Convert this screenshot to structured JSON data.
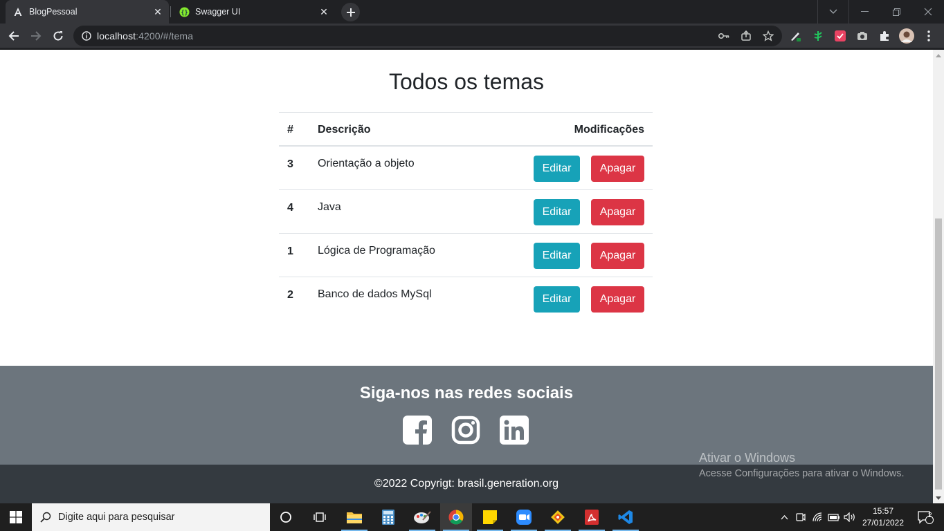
{
  "browser": {
    "tabs": [
      {
        "title": "BlogPessoal"
      },
      {
        "title": "Swagger UI"
      }
    ],
    "url_host": "localhost",
    "url_path": ":4200/#/tema"
  },
  "page": {
    "title": "Todos os temas",
    "table": {
      "headers": [
        "#",
        "Descrição",
        "Modificações"
      ],
      "rows": [
        {
          "id": "3",
          "descricao": "Orientação a objeto"
        },
        {
          "id": "4",
          "descricao": "Java"
        },
        {
          "id": "1",
          "descricao": "Lógica de Programação"
        },
        {
          "id": "2",
          "descricao": "Banco de dados MySql"
        }
      ],
      "edit_label": "Editar",
      "delete_label": "Apagar"
    },
    "footer": {
      "social_heading": "Siga-nos nas redes sociais",
      "social_icons": [
        "facebook-icon",
        "instagram-icon",
        "linkedin-icon"
      ],
      "copyright": "©2022 Copyrigt: brasil.generation.org"
    }
  },
  "watermark": {
    "line1": "Ativar o Windows",
    "line2": "Acesse Configurações para ativar o Windows."
  },
  "taskbar": {
    "search_placeholder": "Digite aqui para pesquisar",
    "time": "15:57",
    "date": "27/01/2022",
    "notification_count": "2"
  },
  "colors": {
    "edit": "#17a2b8",
    "delete": "#dc3545",
    "footer_social": "#6c757d",
    "footer_copy": "#343a40"
  }
}
